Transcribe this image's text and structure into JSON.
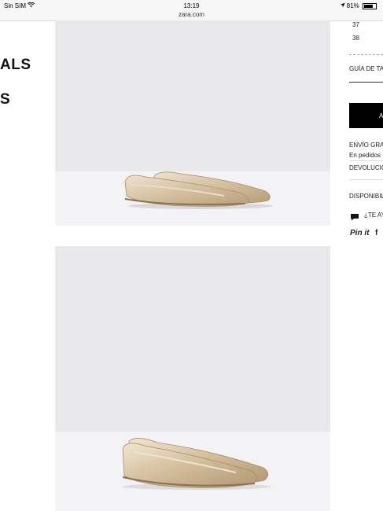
{
  "status_bar": {
    "carrier": "Sin SIM",
    "time": "13:19",
    "battery": "81%"
  },
  "browser": {
    "url": "zara.com"
  },
  "title_fragments": [
    "ALS",
    "S"
  ],
  "sizes": [
    "37",
    "38"
  ],
  "size_guide": "GUÍA DE TA",
  "add_button": "A",
  "shipping": {
    "line1": "ENVÍO GRA",
    "line2": "En pedidos"
  },
  "returns": "DEVOLUCIO",
  "availability": "DISPONIBIL",
  "chat": "¿TE AY",
  "social": {
    "pinterest": "Pin it",
    "facebook": "f"
  }
}
